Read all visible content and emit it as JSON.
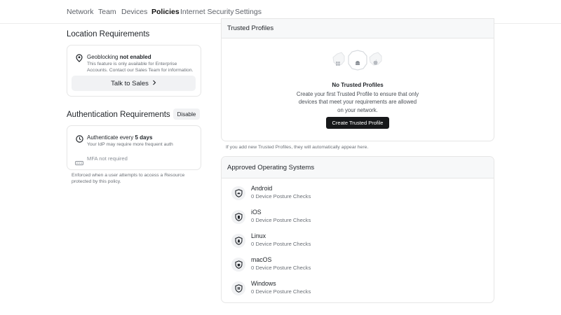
{
  "nav": {
    "tabs": [
      {
        "label": "Network"
      },
      {
        "label": "Team"
      },
      {
        "label": "Devices"
      },
      {
        "label": "Policies",
        "active": true
      },
      {
        "label": "Internet Security"
      },
      {
        "label": "Settings"
      }
    ]
  },
  "location": {
    "title": "Location Requirements",
    "geo_prefix": "Geoblocking",
    "geo_status": "not enabled",
    "geo_desc_1": "This feature is only available for Enterprise",
    "geo_desc_2": "Accounts. Contact our Sales Team for information.",
    "talk_label": "Talk to Sales",
    "icon": "location-pin-icon"
  },
  "auth": {
    "title": "Authentication Requirements",
    "disable_label": "Disable",
    "every_prefix": "Authenticate every",
    "every_value": "5 days",
    "idp_note": "Your IdP may require more frequent auth",
    "mfa_label": "MFA not required",
    "footer_1": "Enforced when a user attempts to access a Resource",
    "footer_2": "protected by this policy."
  },
  "trusted": {
    "title": "Trusted Profiles",
    "empty_title": "No Trusted Profiles",
    "empty_desc_1": "Create your first Trusted Profile to ensure that only",
    "empty_desc_2": "devices that meet your requirements are allowed",
    "empty_desc_3": "on your network.",
    "create_label": "Create Trusted Profile",
    "hint": "If you add new Trusted Profiles, they will automatically appear here."
  },
  "approved_os": {
    "title": "Approved Operating Systems",
    "items": [
      {
        "name": "Android",
        "checks": "0 Device Posture Checks"
      },
      {
        "name": "iOS",
        "checks": "0 Device Posture Checks"
      },
      {
        "name": "Linux",
        "checks": "0 Device Posture Checks"
      },
      {
        "name": "macOS",
        "checks": "0 Device Posture Checks"
      },
      {
        "name": "Windows",
        "checks": "0 Device Posture Checks"
      }
    ]
  },
  "colors": {
    "primary_button": "#17181a",
    "panel_header": "#f7f8f9",
    "border": "#e6e6e6"
  }
}
